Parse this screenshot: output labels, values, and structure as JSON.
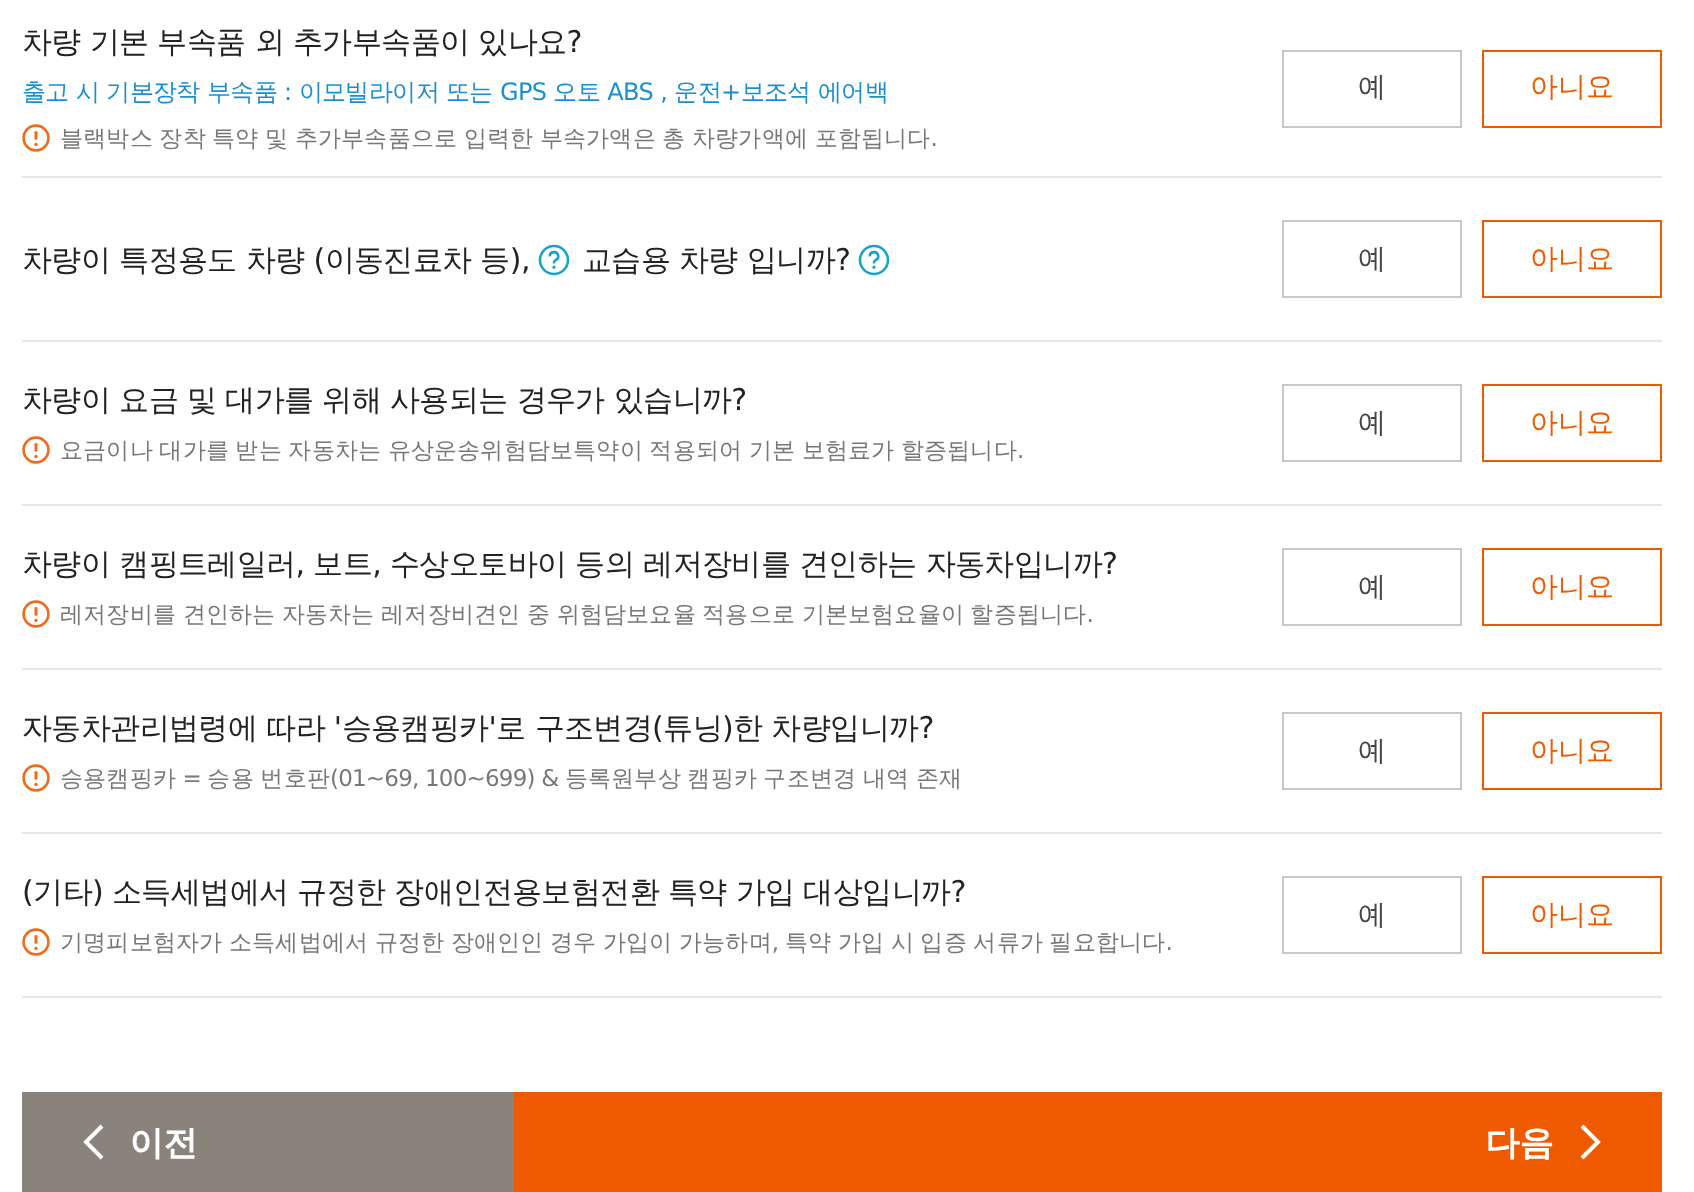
{
  "questions": [
    {
      "parts": [
        {
          "text": "차량 기본 부속품 외 추가부속품이 있나요?",
          "help": false
        }
      ],
      "info": "출고 시 기본장착 부속품 : 이모빌라이저 또는 GPS 오토 ABS , 운전+보조석 에어백",
      "note": "블랙박스 장착 특약 및 추가부속품으로 입력한 부속가액은 총 차량가액에 포함됩니다.",
      "options": [
        {
          "label": "예",
          "selected": false
        },
        {
          "label": "아니요",
          "selected": true
        }
      ]
    },
    {
      "parts": [
        {
          "text": "차량이 특정용도 차량 (이동진료차 등),",
          "help": true
        },
        {
          "text": "교습용 차량 입니까?",
          "help": true
        }
      ],
      "options": [
        {
          "label": "예",
          "selected": false
        },
        {
          "label": "아니요",
          "selected": true
        }
      ]
    },
    {
      "parts": [
        {
          "text": "차량이 요금 및 대가를 위해 사용되는 경우가 있습니까?",
          "help": false
        }
      ],
      "note": "요금이나 대가를 받는 자동차는 유상운송위험담보특약이 적용되어 기본 보험료가 할증됩니다.",
      "options": [
        {
          "label": "예",
          "selected": false
        },
        {
          "label": "아니요",
          "selected": true
        }
      ]
    },
    {
      "parts": [
        {
          "text": "차량이 캠핑트레일러, 보트, 수상오토바이 등의 레저장비를 견인하는 자동차입니까?",
          "help": false
        }
      ],
      "note": "레저장비를 견인하는 자동차는 레저장비견인 중 위험담보요율 적용으로 기본보험요율이 할증됩니다.",
      "options": [
        {
          "label": "예",
          "selected": false
        },
        {
          "label": "아니요",
          "selected": true
        }
      ]
    },
    {
      "parts": [
        {
          "text": "자동차관리법령에 따라 '승용캠핑카'로 구조변경(튜닝)한 차량입니까?",
          "help": false
        }
      ],
      "note": "승용캠핑카 = 승용 번호판(01~69, 100~699) & 등록원부상 캠핑카 구조변경 내역 존재",
      "options": [
        {
          "label": "예",
          "selected": false
        },
        {
          "label": "아니요",
          "selected": true
        }
      ]
    },
    {
      "parts": [
        {
          "text": "(기타) 소득세법에서 규정한 장애인전용보험전환 특약 가입 대상입니까?",
          "help": false
        }
      ],
      "note": "기명피보험자가 소득세법에서 규정한 장애인인 경우 가입이 가능하며, 특약 가입 시 입증 서류가 필요합니다.",
      "options": [
        {
          "label": "예",
          "selected": false
        },
        {
          "label": "아니요",
          "selected": true
        }
      ]
    }
  ],
  "nav": {
    "prev": "이전",
    "next": "다음"
  }
}
